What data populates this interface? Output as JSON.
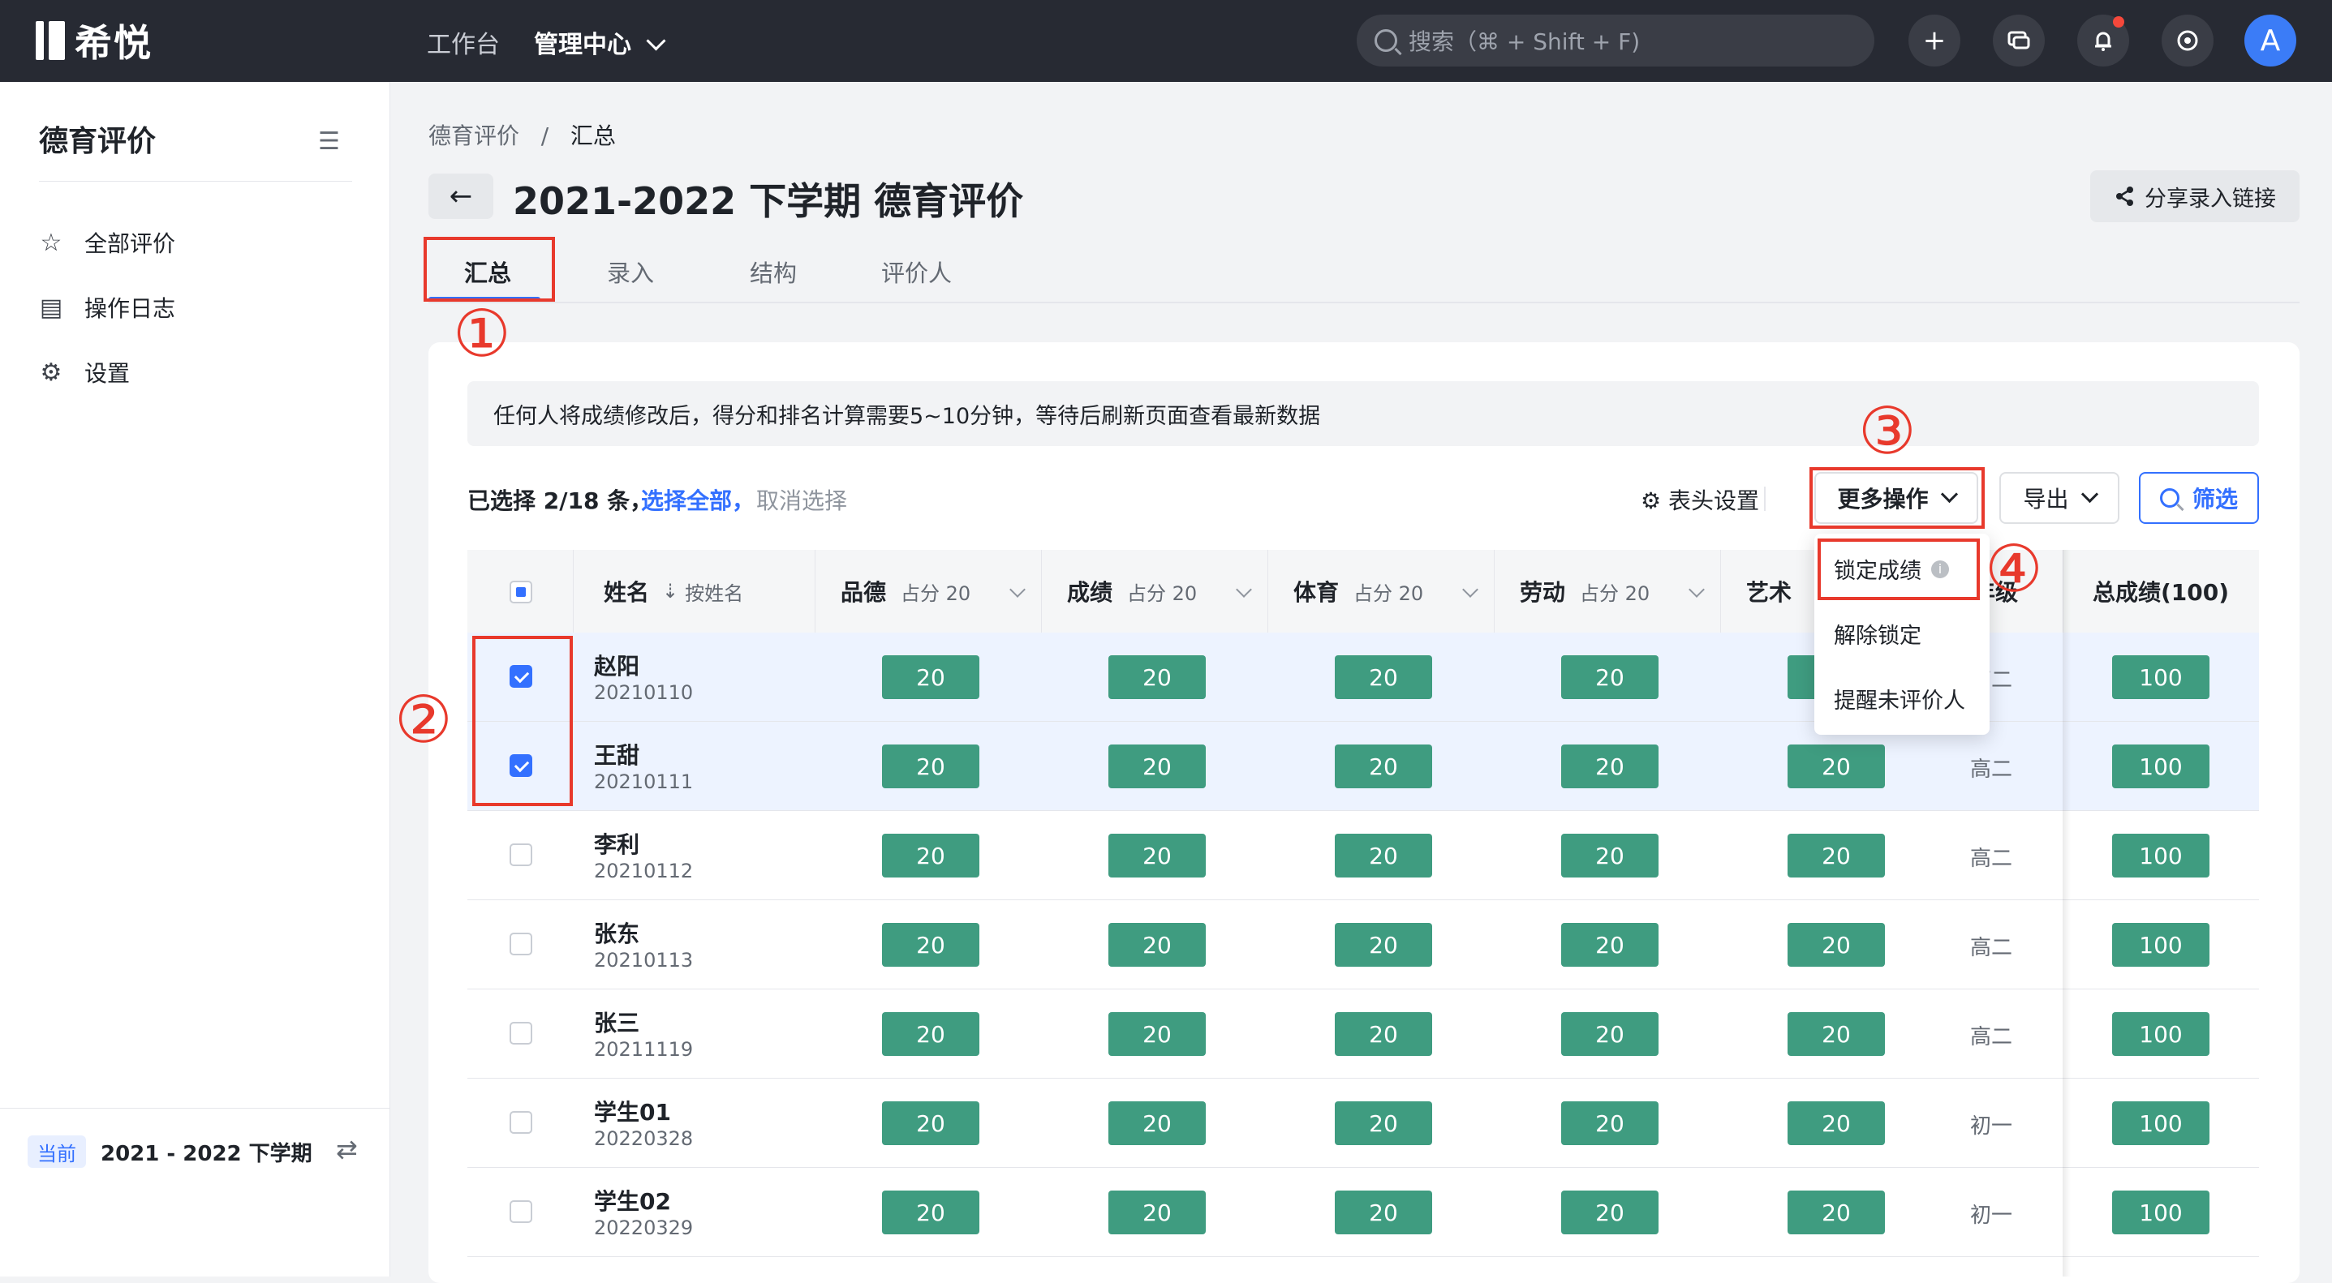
{
  "topbar": {
    "logo_text": "希悦",
    "nav": [
      "工作台",
      "管理中心"
    ],
    "search_placeholder": "搜索（⌘ + Shift + F)",
    "avatar_letter": "A"
  },
  "sidebar": {
    "title": "德育评价",
    "items": [
      {
        "label": "全部评价",
        "icon": "star-icon"
      },
      {
        "label": "操作日志",
        "icon": "log-icon"
      },
      {
        "label": "设置",
        "icon": "gear-icon"
      }
    ],
    "term_badge": "当前",
    "term_text": "2021 - 2022 下学期"
  },
  "main": {
    "breadcrumb": [
      "德育评价",
      "汇总"
    ],
    "title": "2021-2022 下学期 德育评价",
    "share_label": "分享录入链接",
    "tabs": [
      "汇总",
      "录入",
      "结构",
      "评价人"
    ],
    "notice": "任何人将成绩修改后，得分和排名计算需要5~10分钟，等待后刷新页面查看最新数据",
    "selection": {
      "info": "已选择 2/18 条，",
      "select_all": "选择全部，",
      "cancel": "取消选择"
    },
    "toolbar": {
      "header_settings": "表头设置",
      "more": "更多操作",
      "export": "导出",
      "filter": "筛选"
    },
    "dropdown": [
      "锁定成绩",
      "解除锁定",
      "提醒未评价人"
    ]
  },
  "table": {
    "headers": {
      "name": "姓名",
      "sort": "按姓名",
      "weight": "占分 20",
      "cols": [
        "品德",
        "成绩",
        "体育",
        "劳动",
        "艺术"
      ],
      "grade": "年级",
      "total": "总成绩(100)"
    },
    "rows": [
      {
        "name": "赵阳",
        "id": "20210110",
        "scores": [
          "20",
          "20",
          "20",
          "20",
          "20"
        ],
        "grade": "高二",
        "total": "100",
        "checked": true
      },
      {
        "name": "王甜",
        "id": "20210111",
        "scores": [
          "20",
          "20",
          "20",
          "20",
          "20"
        ],
        "grade": "高二",
        "total": "100",
        "checked": true
      },
      {
        "name": "李利",
        "id": "20210112",
        "scores": [
          "20",
          "20",
          "20",
          "20",
          "20"
        ],
        "grade": "高二",
        "total": "100",
        "checked": false
      },
      {
        "name": "张东",
        "id": "20210113",
        "scores": [
          "20",
          "20",
          "20",
          "20",
          "20"
        ],
        "grade": "高二",
        "total": "100",
        "checked": false
      },
      {
        "name": "张三",
        "id": "20211119",
        "scores": [
          "20",
          "20",
          "20",
          "20",
          "20"
        ],
        "grade": "高二",
        "total": "100",
        "checked": false
      },
      {
        "name": "学生01",
        "id": "20220328",
        "scores": [
          "20",
          "20",
          "20",
          "20",
          "20"
        ],
        "grade": "初一",
        "total": "100",
        "checked": false
      },
      {
        "name": "学生02",
        "id": "20220329",
        "scores": [
          "20",
          "20",
          "20",
          "20",
          "20"
        ],
        "grade": "初一",
        "total": "100",
        "checked": false
      }
    ]
  },
  "annotations": [
    "①",
    "②",
    "③",
    "④"
  ],
  "colors": {
    "accent": "#3370ff",
    "score_bg": "#3f9c80",
    "annotation": "#e8392c",
    "topbar": "#272a33"
  }
}
